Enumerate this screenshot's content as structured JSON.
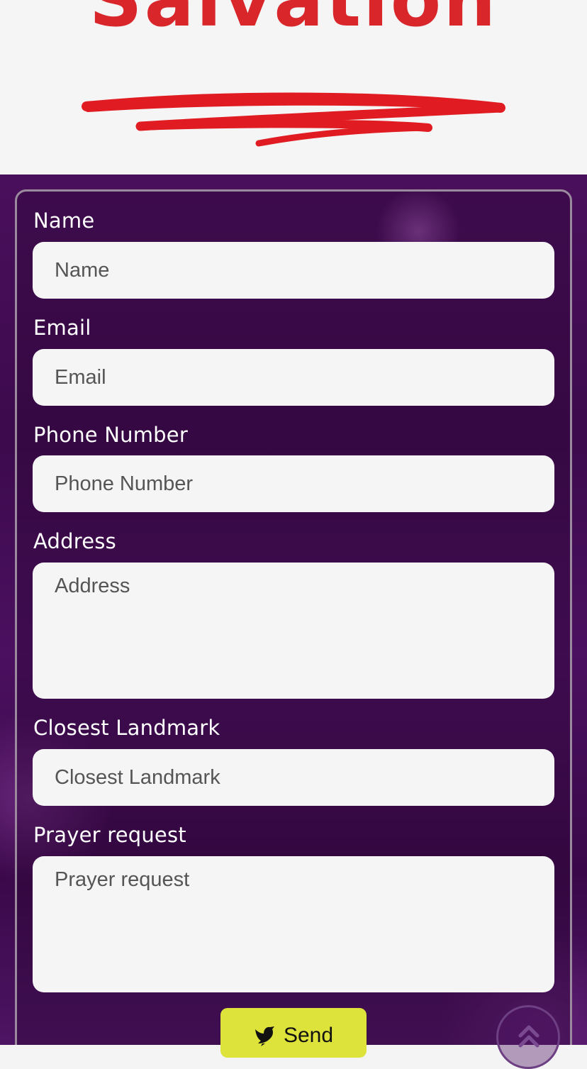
{
  "header": {
    "headline": "Salvation",
    "colors": {
      "headline": "#d9262b",
      "scribble": "#e01c22"
    }
  },
  "form": {
    "fields": [
      {
        "label": "Name",
        "placeholder": "Name"
      },
      {
        "label": "Email",
        "placeholder": "Email"
      },
      {
        "label": "Phone Number",
        "placeholder": "Phone Number"
      },
      {
        "label": "Address",
        "placeholder": "Address"
      },
      {
        "label": "Closest Landmark",
        "placeholder": "Closest Landmark"
      },
      {
        "label": "Prayer request",
        "placeholder": "Prayer request"
      }
    ],
    "send_label": "Send",
    "send_icon": "dove-icon",
    "colors": {
      "button": "#dde33a",
      "background": "#4a0f5c"
    }
  },
  "scroll_top": {
    "icon": "double-chevron-up-icon"
  }
}
